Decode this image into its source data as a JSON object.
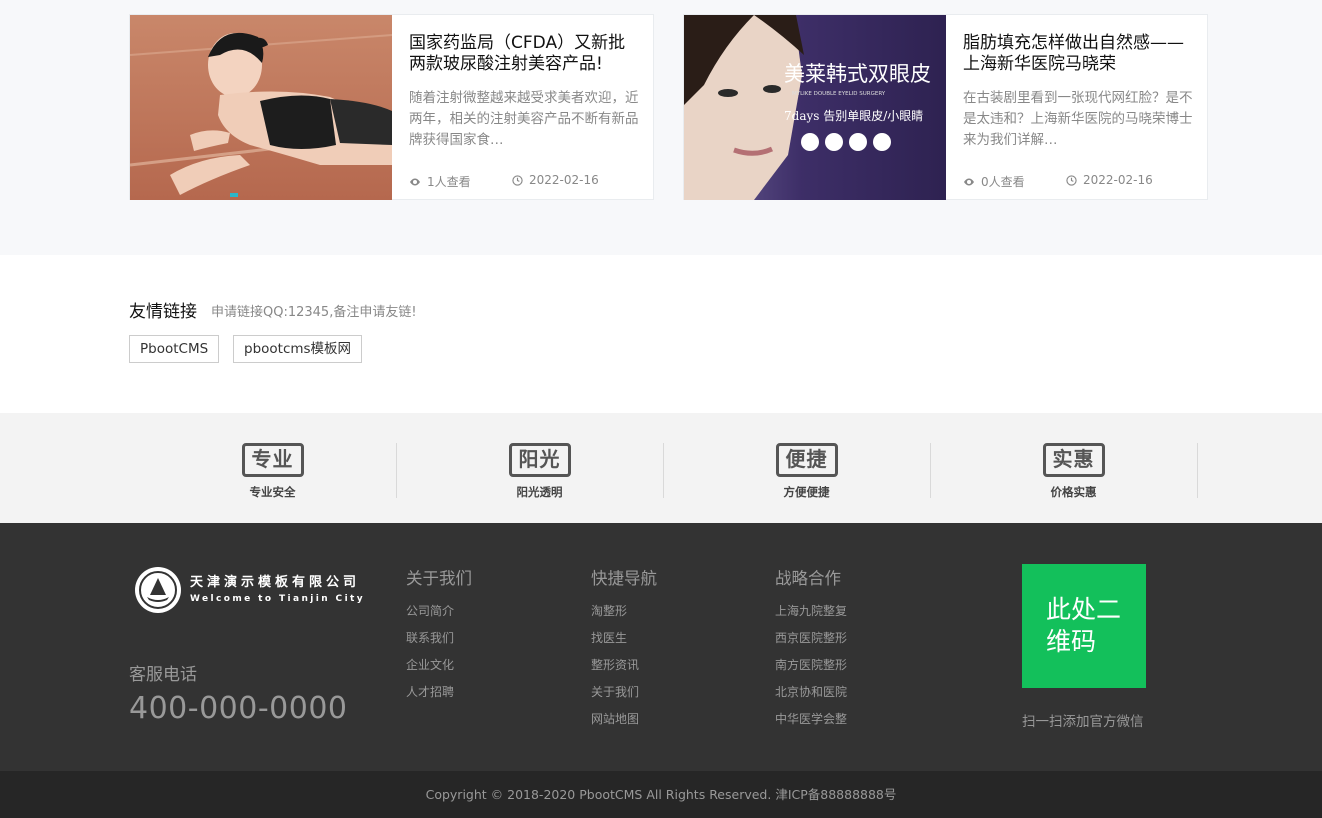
{
  "news": [
    {
      "title": "国家药监局（CFDA）又新批两款玻尿酸注射美容产品!",
      "desc": "随着注射微整越来越受求美者欢迎，近两年，相关的注射美容产品不断有新品牌获得国家食…",
      "views": "1人查看",
      "date": "2022-02-16"
    },
    {
      "title": "脂肪填充怎样做出自然感——上海新华医院马晓荣",
      "desc": "在古装剧里看到一张现代网红脸？是不是太违和？上海新华医院的马晓荣博士来为我们详解…",
      "views": "0人查看",
      "date": "2022-02-16",
      "image_text": {
        "headline": "美莱韩式双眼皮",
        "en": "MYLIKE DOUBLE EYELID SURGERY",
        "sub": "7days 告别单眼皮/小眼睛"
      }
    }
  ],
  "links": {
    "heading": "友情链接",
    "apply": "申请链接QQ:12345,备注申请友链!",
    "items": [
      "PbootCMS",
      "pbootcms模板网"
    ]
  },
  "features": [
    {
      "badge": "专业",
      "caption": "专业安全"
    },
    {
      "badge": "阳光",
      "caption": "阳光透明"
    },
    {
      "badge": "便捷",
      "caption": "方便便捷"
    },
    {
      "badge": "实惠",
      "caption": "价格实惠"
    }
  ],
  "footer": {
    "logo_title": "天津演示模板有限公司",
    "logo_sub": "Welcome to Tianjin City",
    "tel_label": "客服电话",
    "tel": "400-000-0000",
    "columns": [
      {
        "title": "关于我们",
        "items": [
          "公司简介",
          "联系我们",
          "企业文化",
          "人才招聘"
        ]
      },
      {
        "title": "快捷导航",
        "items": [
          "淘整形",
          "找医生",
          "整形资讯",
          "关于我们",
          "网站地图"
        ]
      },
      {
        "title": "战略合作",
        "items": [
          "上海九院整复",
          "西京医院整形",
          "南方医院整形",
          "北京协和医院",
          "中华医学会整"
        ]
      }
    ],
    "qr_text": "此处二维码",
    "qr_caption": "扫一扫添加官方微信"
  },
  "copyright": "Copyright © 2018-2020 PbootCMS All Rights Reserved. 津ICP备88888888号",
  "colors": {
    "qr_green": "#13c05b",
    "footer_bg": "#333333",
    "copyright_bg": "#262626",
    "banner_purple": "#3a2c62"
  }
}
